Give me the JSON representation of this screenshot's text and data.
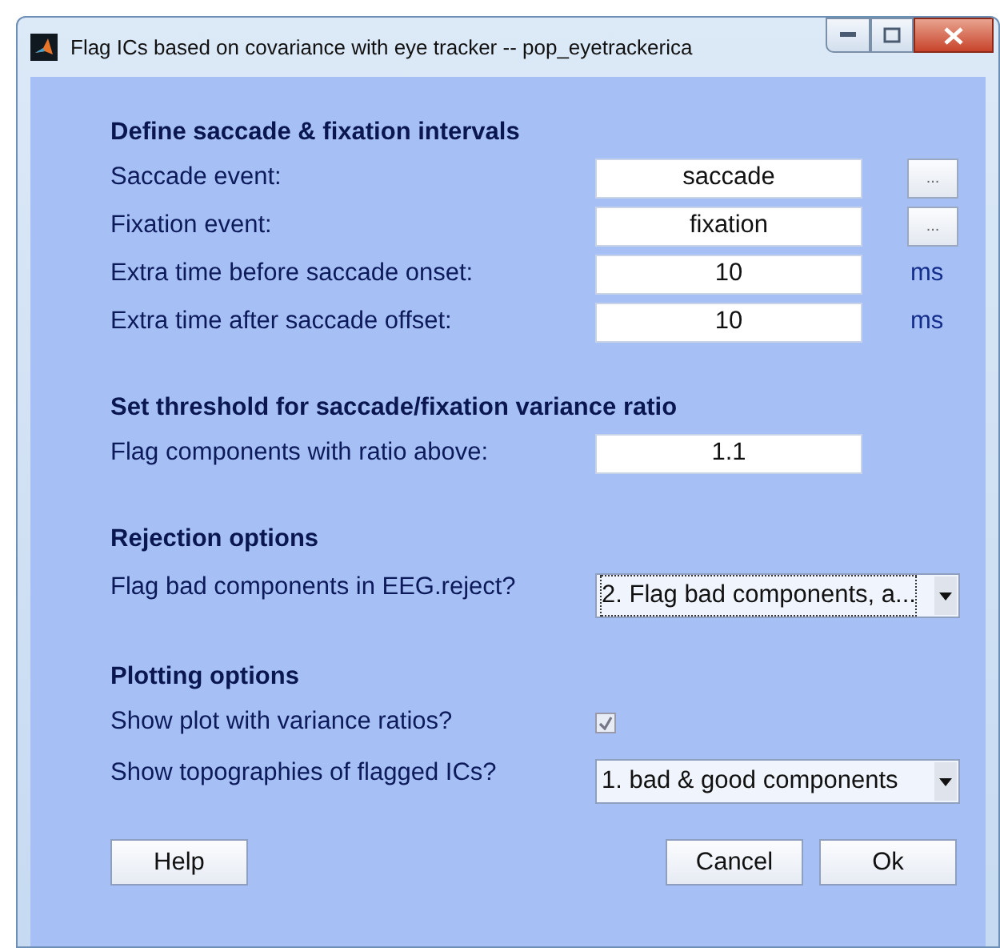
{
  "window": {
    "title": "Flag ICs based on covariance with eye tracker -- pop_eyetrackerica"
  },
  "sections": [
    {
      "heading": "Define saccade & fixation intervals",
      "rows": [
        {
          "kind": "field",
          "label": "Saccade event:",
          "value": "saccade",
          "browse": "..."
        },
        {
          "kind": "field",
          "label": "Fixation event:",
          "value": "fixation",
          "browse": "..."
        },
        {
          "kind": "field",
          "label": "Extra time before saccade onset:",
          "value": "10",
          "unit": "ms"
        },
        {
          "kind": "field",
          "label": "Extra time after saccade offset:",
          "value": "10",
          "unit": "ms"
        }
      ]
    },
    {
      "heading": "Set threshold for saccade/fixation variance ratio",
      "rows": [
        {
          "kind": "field",
          "label": "Flag components with ratio above:",
          "value": "1.1"
        }
      ]
    },
    {
      "heading": "Rejection options",
      "rows": [
        {
          "kind": "select",
          "label": "Flag bad components in EEG.reject?",
          "value": "2. Flag bad components, a...",
          "focused": true
        }
      ]
    },
    {
      "heading": "Plotting options",
      "rows": [
        {
          "kind": "checkbox",
          "label": "Show plot with variance ratios?",
          "checked": true
        },
        {
          "kind": "select",
          "label": "Show topographies of flagged ICs?",
          "value": "1. bad & good components",
          "focused": false
        }
      ]
    }
  ],
  "buttons": {
    "help": "Help",
    "cancel": "Cancel",
    "ok": "Ok"
  }
}
